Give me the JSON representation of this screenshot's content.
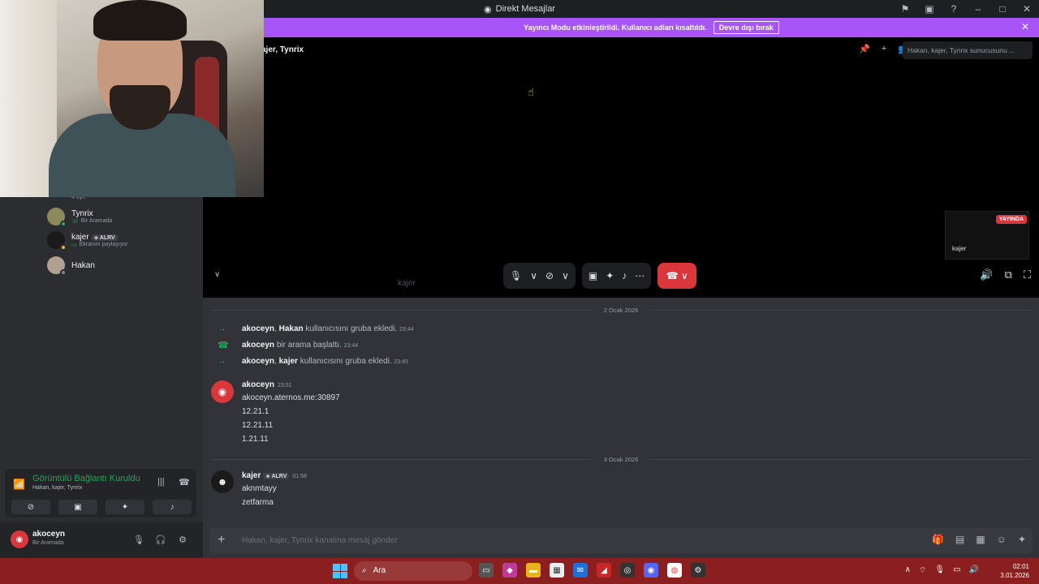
{
  "window": {
    "title": "Direkt Mesajlar"
  },
  "banner": {
    "text": "Yayıncı Modu etkinleştirildi. Kullanıcı adları kısaltıldı.",
    "button": "Devre dışı bırak"
  },
  "sidebar": {
    "member_count": "4 üye",
    "members": [
      {
        "name": "Tynrix",
        "status": "Bir Aramada"
      },
      {
        "name": "kajer",
        "badge": "ALRV",
        "status": "Ekranını paylaşıyor"
      },
      {
        "name": "Hakan",
        "status": ""
      }
    ],
    "voice": {
      "title": "Görüntülü Bağlantı Kuruldu",
      "subtitle": "Hakan, kajer, Tynrix"
    },
    "user": {
      "name": "akoceyn",
      "status": "Bir Aramada"
    }
  },
  "call": {
    "title": "ajer, Tynrix",
    "search_placeholder": "Hakan, kajer, Tynrix sunucusunu ...",
    "live_badge": "YAYINDA",
    "preview_name": "kajer",
    "watermark": "kajer"
  },
  "chat": {
    "date1": "2 Ocak 2026",
    "system": [
      {
        "actor": "akoceyn",
        "target": "Hakan",
        "text": "kullanıcısını gruba ekledi.",
        "time": "23:44"
      },
      {
        "actor": "akoceyn",
        "target": "",
        "text": "bir arama başlattı.",
        "time": "23:44"
      },
      {
        "actor": "akoceyn",
        "target": "kajer",
        "text": "kullanıcısını gruba ekledi.",
        "time": "23:45"
      }
    ],
    "msg1": {
      "author": "akoceyn",
      "time": "23:51",
      "lines": [
        "akoceyn.aternos.me:30897",
        "12.21.1",
        "12.21.11",
        "1.21.11"
      ]
    },
    "date2": "3 Ocak 2026",
    "msg2": {
      "author": "kajer",
      "badge": "ALRV",
      "time": "01:58",
      "lines": [
        "aknmtayy",
        "zetfarma"
      ]
    },
    "composer_placeholder": "Hakan, kajer, Tynrix kanalına mesaj gönder"
  },
  "taskbar": {
    "search": "Ara",
    "time": "02:01",
    "date": "3.01.2026"
  },
  "colors": {
    "accent": "#5865f2",
    "banner": "#a855f7",
    "danger": "#da373c",
    "online": "#23a55a",
    "taskbar": "#8b1e1e"
  }
}
